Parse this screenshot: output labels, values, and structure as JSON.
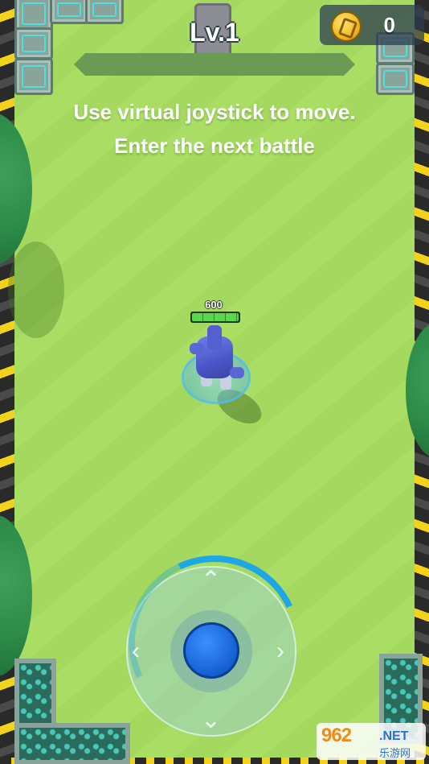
{
  "hud": {
    "level": "Lv.1",
    "level_progress": 0.0,
    "coins": "0"
  },
  "hint": {
    "line1": "Use virtual joystick to move.",
    "line2": "Enter the next battle"
  },
  "player": {
    "hp": "600",
    "hp_fraction": 1.0
  },
  "joystick": {
    "icons": [
      "arrow-up-icon",
      "arrow-down-icon",
      "arrow-left-icon",
      "arrow-right-icon"
    ]
  },
  "watermark": {
    "number": "962",
    "net": ".NET",
    "sub": "乐游网"
  },
  "colors": {
    "grass": "#a9dd63",
    "coin": "#f1b81b",
    "joystick_knob": "#1863d6",
    "hp_fill": "#58d84a",
    "hazard_yellow": "#f2d21a"
  }
}
